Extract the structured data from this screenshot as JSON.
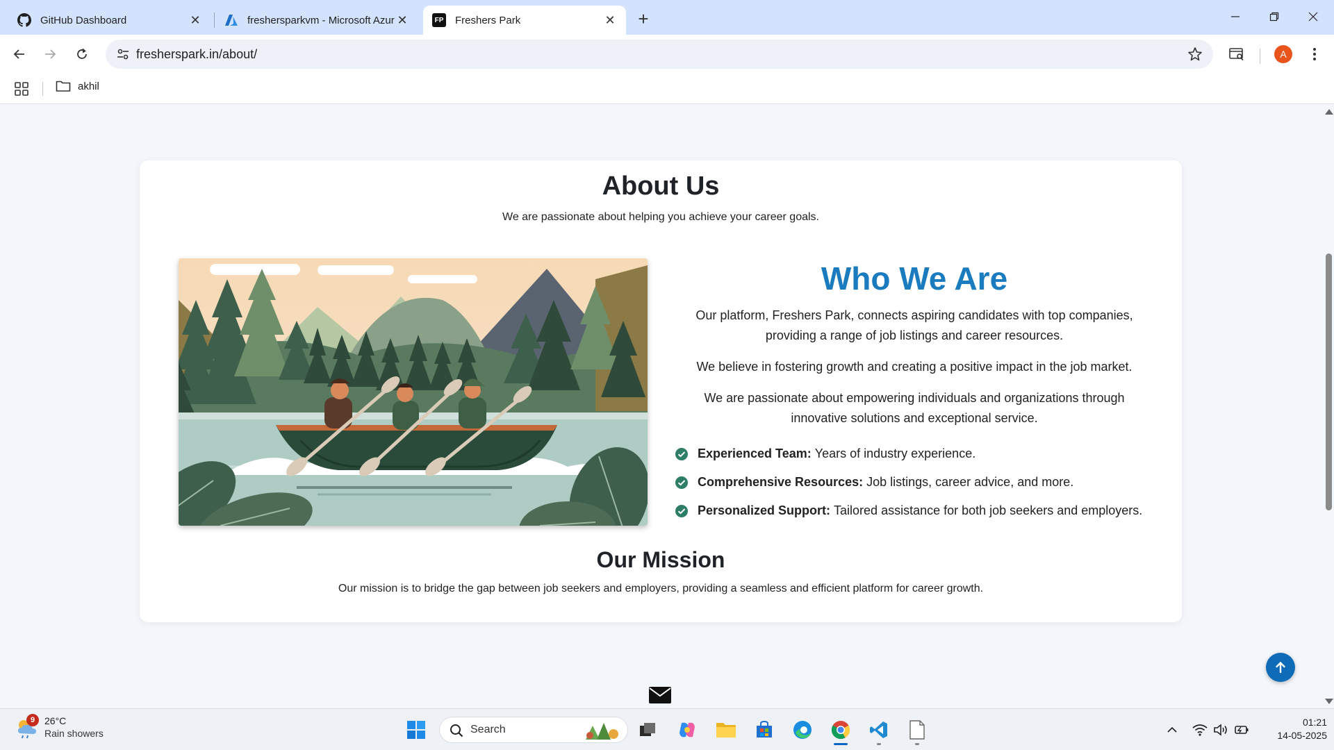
{
  "browser": {
    "tabs": [
      {
        "title": "GitHub Dashboard",
        "icon": "github-icon"
      },
      {
        "title": "freshersparkvm - Microsoft Azure",
        "icon": "azure-icon"
      },
      {
        "title": "Freshers Park",
        "icon": "fp-icon",
        "favicon_text": "FP",
        "active": true
      }
    ],
    "url": "fresherspark.in/about/",
    "profile_initial": "A",
    "bookmarks": [
      {
        "label": "akhil",
        "icon": "folder-icon"
      }
    ]
  },
  "page": {
    "about": {
      "title": "About Us",
      "subtitle": "We are passionate about helping you achieve your career goals."
    },
    "who": {
      "title": "Who We Are",
      "paragraphs": [
        "Our platform, Freshers Park, connects aspiring candidates with top companies, providing a range of job listings and career resources.",
        "We believe in fostering growth and creating a positive impact in the job market.",
        "We are passionate about empowering individuals and organizations through innovative solutions and exceptional service."
      ],
      "features": [
        {
          "label": "Experienced Team:",
          "text": "Years of industry experience."
        },
        {
          "label": "Comprehensive Resources:",
          "text": "Job listings, career advice, and more."
        },
        {
          "label": "Personalized Support:",
          "text": "Tailored assistance for both job seekers and employers."
        }
      ]
    },
    "mission": {
      "title": "Our Mission",
      "text": "Our mission is to bridge the gap between job seekers and employers, providing a seamless and efficient platform for career growth."
    }
  },
  "colors": {
    "accent_blue": "#1a7bbf",
    "check_green": "#2e7d66",
    "to_top_button": "#0e6bb7"
  },
  "taskbar": {
    "weather": {
      "temp": "26°C",
      "condition": "Rain showers",
      "badge": "9"
    },
    "search_placeholder": "Search",
    "time": "01:21",
    "date": "14-05-2025"
  }
}
